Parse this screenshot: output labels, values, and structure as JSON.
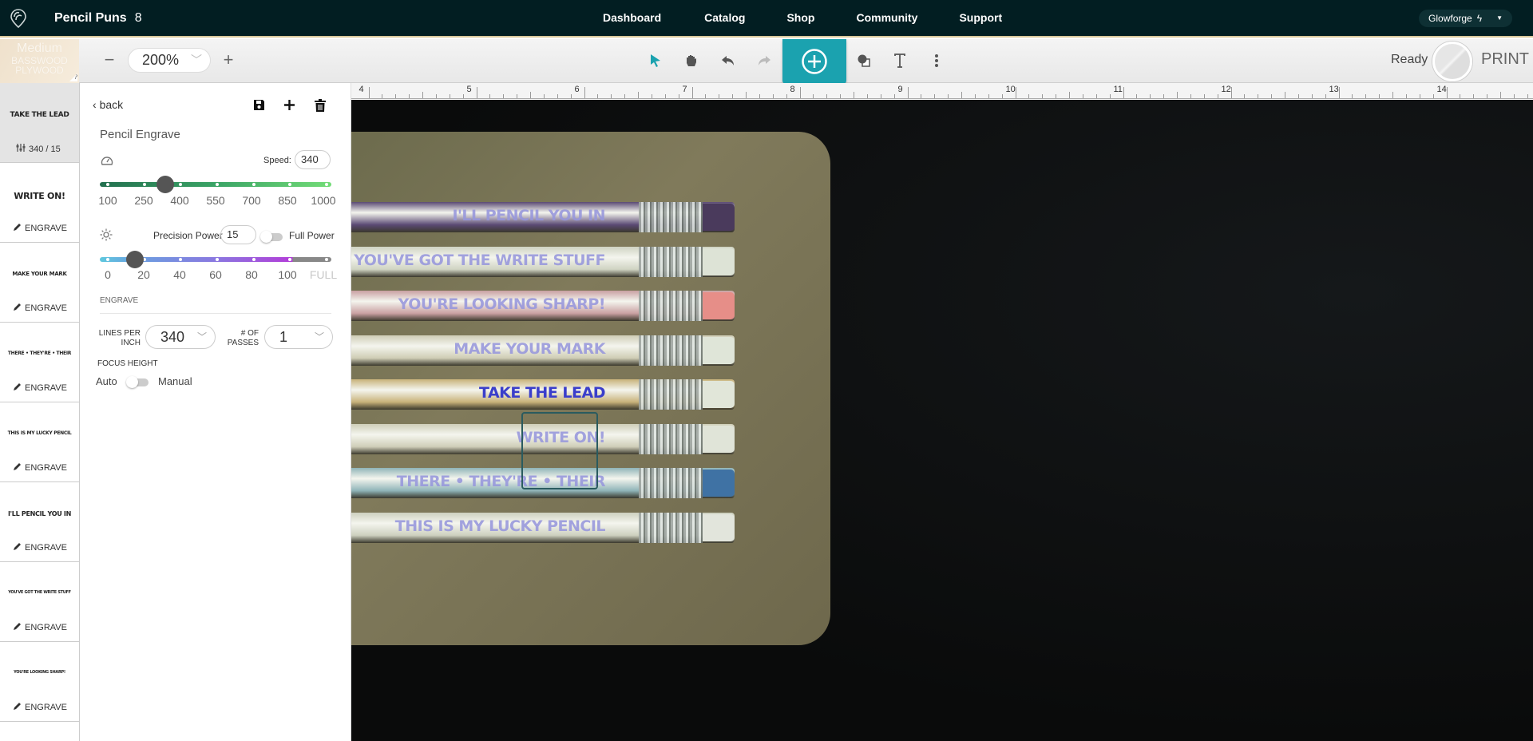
{
  "nav": {
    "project_title": "Pencil Puns",
    "project_count": "8",
    "links": [
      "Dashboard",
      "Catalog",
      "Shop",
      "Community",
      "Support"
    ],
    "machine": "Glowforge"
  },
  "toolbar": {
    "material": {
      "thickness": "Medium",
      "name_line1": "BASSWOOD",
      "name_line2": "PLYWOOD",
      "help": "?"
    },
    "zoom_value": "200%",
    "zoom_minus": "−",
    "zoom_plus": "+",
    "tools": [
      "select-arrow-icon",
      "hand-pan-icon",
      "undo-icon",
      "redo-icon",
      "add-artwork-icon",
      "shapes-icon",
      "text-icon",
      "more-vertical-icon"
    ],
    "status": "Ready",
    "print_label": "PRINT",
    "accent_color": "#1ba2af"
  },
  "ruler": {
    "unit_labels": [
      "4",
      "5",
      "6",
      "7",
      "8",
      "9",
      "10",
      "11",
      "12",
      "13",
      "14"
    ]
  },
  "thumbnails": [
    {
      "art": "TAKE THE LEAD",
      "meta": "340 / 15",
      "meta_icon": "settings-sliders-icon",
      "active": true
    },
    {
      "art": "WRITE ON!",
      "meta": "ENGRAVE",
      "meta_icon": "pencil-icon"
    },
    {
      "art": "MAKE YOUR MARK",
      "meta": "ENGRAVE",
      "meta_icon": "pencil-icon"
    },
    {
      "art": "THERE • THEY'RE • THEIR",
      "meta": "ENGRAVE",
      "meta_icon": "pencil-icon"
    },
    {
      "art": "THIS IS MY LUCKY PENCIL",
      "meta": "ENGRAVE",
      "meta_icon": "pencil-icon"
    },
    {
      "art": "I'LL PENCIL YOU IN",
      "meta": "ENGRAVE",
      "meta_icon": "pencil-icon"
    },
    {
      "art": "YOU'VE GOT THE WRITE STUFF",
      "meta": "ENGRAVE",
      "meta_icon": "pencil-icon"
    },
    {
      "art": "YOU'RE LOOKING SHARP!",
      "meta": "ENGRAVE",
      "meta_icon": "pencil-icon"
    }
  ],
  "settings": {
    "back_label": "back",
    "preset_name": "Pencil Engrave",
    "speed": {
      "label": "Speed:",
      "value": "340",
      "ticks": [
        "100",
        "250",
        "400",
        "550",
        "700",
        "850",
        "1000"
      ],
      "min": 100,
      "max": 1000,
      "current": 340
    },
    "power": {
      "label": "Precision Power",
      "value": "15",
      "full_power_label": "Full Power",
      "full_power_on": false,
      "ticks": [
        "0",
        "20",
        "40",
        "60",
        "80",
        "100",
        "FULL"
      ],
      "current": 15
    },
    "section": "ENGRAVE",
    "lpi": {
      "label_line1": "LINES PER",
      "label_line2": "INCH",
      "value": "340"
    },
    "passes": {
      "label_line1": "# OF",
      "label_line2": "PASSES",
      "value": "1"
    },
    "focus": {
      "label": "FOCUS HEIGHT",
      "auto": "Auto",
      "manual": "Manual",
      "manual_on": false
    }
  },
  "canvas": {
    "pencils": [
      {
        "text": "I'LL PENCIL YOU IN",
        "body": "#5b4a74",
        "eraser": "#4a3a5c"
      },
      {
        "text": "YOU'VE GOT THE WRITE STUFF",
        "body": "#cfd3c2",
        "eraser": "#dde3d6"
      },
      {
        "text": "YOU'RE LOOKING SHARP!",
        "body": "#c9a0a2",
        "eraser": "#e68e88"
      },
      {
        "text": "MAKE YOUR MARK",
        "body": "#cfcdb5",
        "eraser": "#dfe5d8"
      },
      {
        "text": "TAKE THE LEAD",
        "body": "#c8b27a",
        "eraser": "#e1e6d9",
        "selected": true
      },
      {
        "text": "WRITE ON!",
        "body": "#cfceb8",
        "eraser": "#e0e4d8"
      },
      {
        "text": "THERE • THEY'RE • THEIR",
        "body": "#8fb4b8",
        "eraser": "#3f72a4"
      },
      {
        "text": "THIS IS MY LUCKY PENCIL",
        "body": "#cdd0bf",
        "eraser": "#e2e5dc"
      }
    ]
  }
}
